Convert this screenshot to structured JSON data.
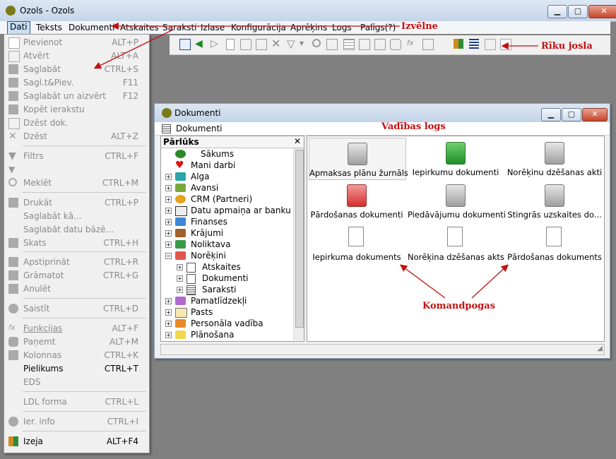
{
  "app": {
    "title": "Ozols - Ozols"
  },
  "menubar": {
    "items": [
      "Dati",
      "Teksts",
      "Dokumenti",
      "Atskaites",
      "Saraksti",
      "Izlase",
      "Konfigurācija",
      "Aprēķins",
      "Logs",
      "Palīgs(?)"
    ]
  },
  "annotations": {
    "menu": "Izvēlne",
    "toolbar": "Rīku josla",
    "control_window": "Vadības logs",
    "command_buttons": "Komandpogas"
  },
  "dropdown": {
    "items": [
      {
        "label": "Pievienot",
        "shortcut": "ALT+P"
      },
      {
        "label": "Atvērt",
        "shortcut": "ALT+A"
      },
      {
        "label": "Saglabāt",
        "shortcut": "CTRL+S"
      },
      {
        "label": "Sagl.t&Piev.",
        "shortcut": "F11"
      },
      {
        "label": "Saglabāt un aizvērt",
        "shortcut": "F12"
      },
      {
        "label": "Kopēt ierakstu",
        "shortcut": ""
      },
      {
        "label": "Dzēst dok.",
        "shortcut": ""
      },
      {
        "label": "Dzēst",
        "shortcut": "ALT+Z"
      },
      {
        "label": "Filtrs",
        "shortcut": "CTRL+F"
      },
      {
        "label": "",
        "shortcut": ""
      },
      {
        "label": "Meklēt",
        "shortcut": "CTRL+M"
      },
      {
        "label": "Drukāt",
        "shortcut": "CTRL+P"
      },
      {
        "label": "Saglabāt kā...",
        "shortcut": ""
      },
      {
        "label": "Saglabāt datu bāzē...",
        "shortcut": ""
      },
      {
        "label": "Skats",
        "shortcut": "CTRL+H"
      },
      {
        "label": "Apstiprināt",
        "shortcut": "CTRL+R"
      },
      {
        "label": "Grāmatot",
        "shortcut": "CTRL+G"
      },
      {
        "label": "Anulēt",
        "shortcut": ""
      },
      {
        "label": "Saistīt",
        "shortcut": "CTRL+D"
      },
      {
        "label": "Funkcijas",
        "shortcut": "ALT+F"
      },
      {
        "label": "Paņemt",
        "shortcut": "ALT+M"
      },
      {
        "label": "Kolonnas",
        "shortcut": "CTRL+K"
      },
      {
        "label": "Pielikums",
        "shortcut": "CTRL+T"
      },
      {
        "label": "EDS",
        "shortcut": ""
      },
      {
        "label": "LDL forma",
        "shortcut": "CTRL+L"
      },
      {
        "label": "Ier. info",
        "shortcut": "CTRL+I"
      },
      {
        "label": "Izeja",
        "shortcut": "ALT+F4"
      }
    ]
  },
  "docwin": {
    "title": "Dokumenti",
    "sub_label": "Dokumenti",
    "explorer_title": "Pārlūks",
    "explorer_close": "✕",
    "tree": [
      "Sākums",
      "Mani darbi",
      "Alga",
      "Avansi",
      "CRM (Partneri)",
      "Datu apmaiņa ar banku",
      "Finanses",
      "Krājumi",
      "Noliktava",
      "Norēķini",
      "Atskaites",
      "Dokumenti",
      "Saraksti",
      "Pamatlīdzekļi",
      "Pasts",
      "Personāla vadība",
      "Plānošana"
    ],
    "commands": [
      "Apmaksas plānu žurnāls",
      "Iepirkumu dokumenti",
      "Norēķinu dzēšanas akti",
      "Pārdošanas dokumenti",
      "Piedāvājumu dokumenti",
      "Stingrās uzskaites do...",
      "Iepirkuma dokuments",
      "Norēķina dzēšanas akts",
      "Pārdošanas dokuments"
    ]
  },
  "colors": {
    "annotation": "#c21010",
    "menu_highlight": "#c9def5"
  }
}
